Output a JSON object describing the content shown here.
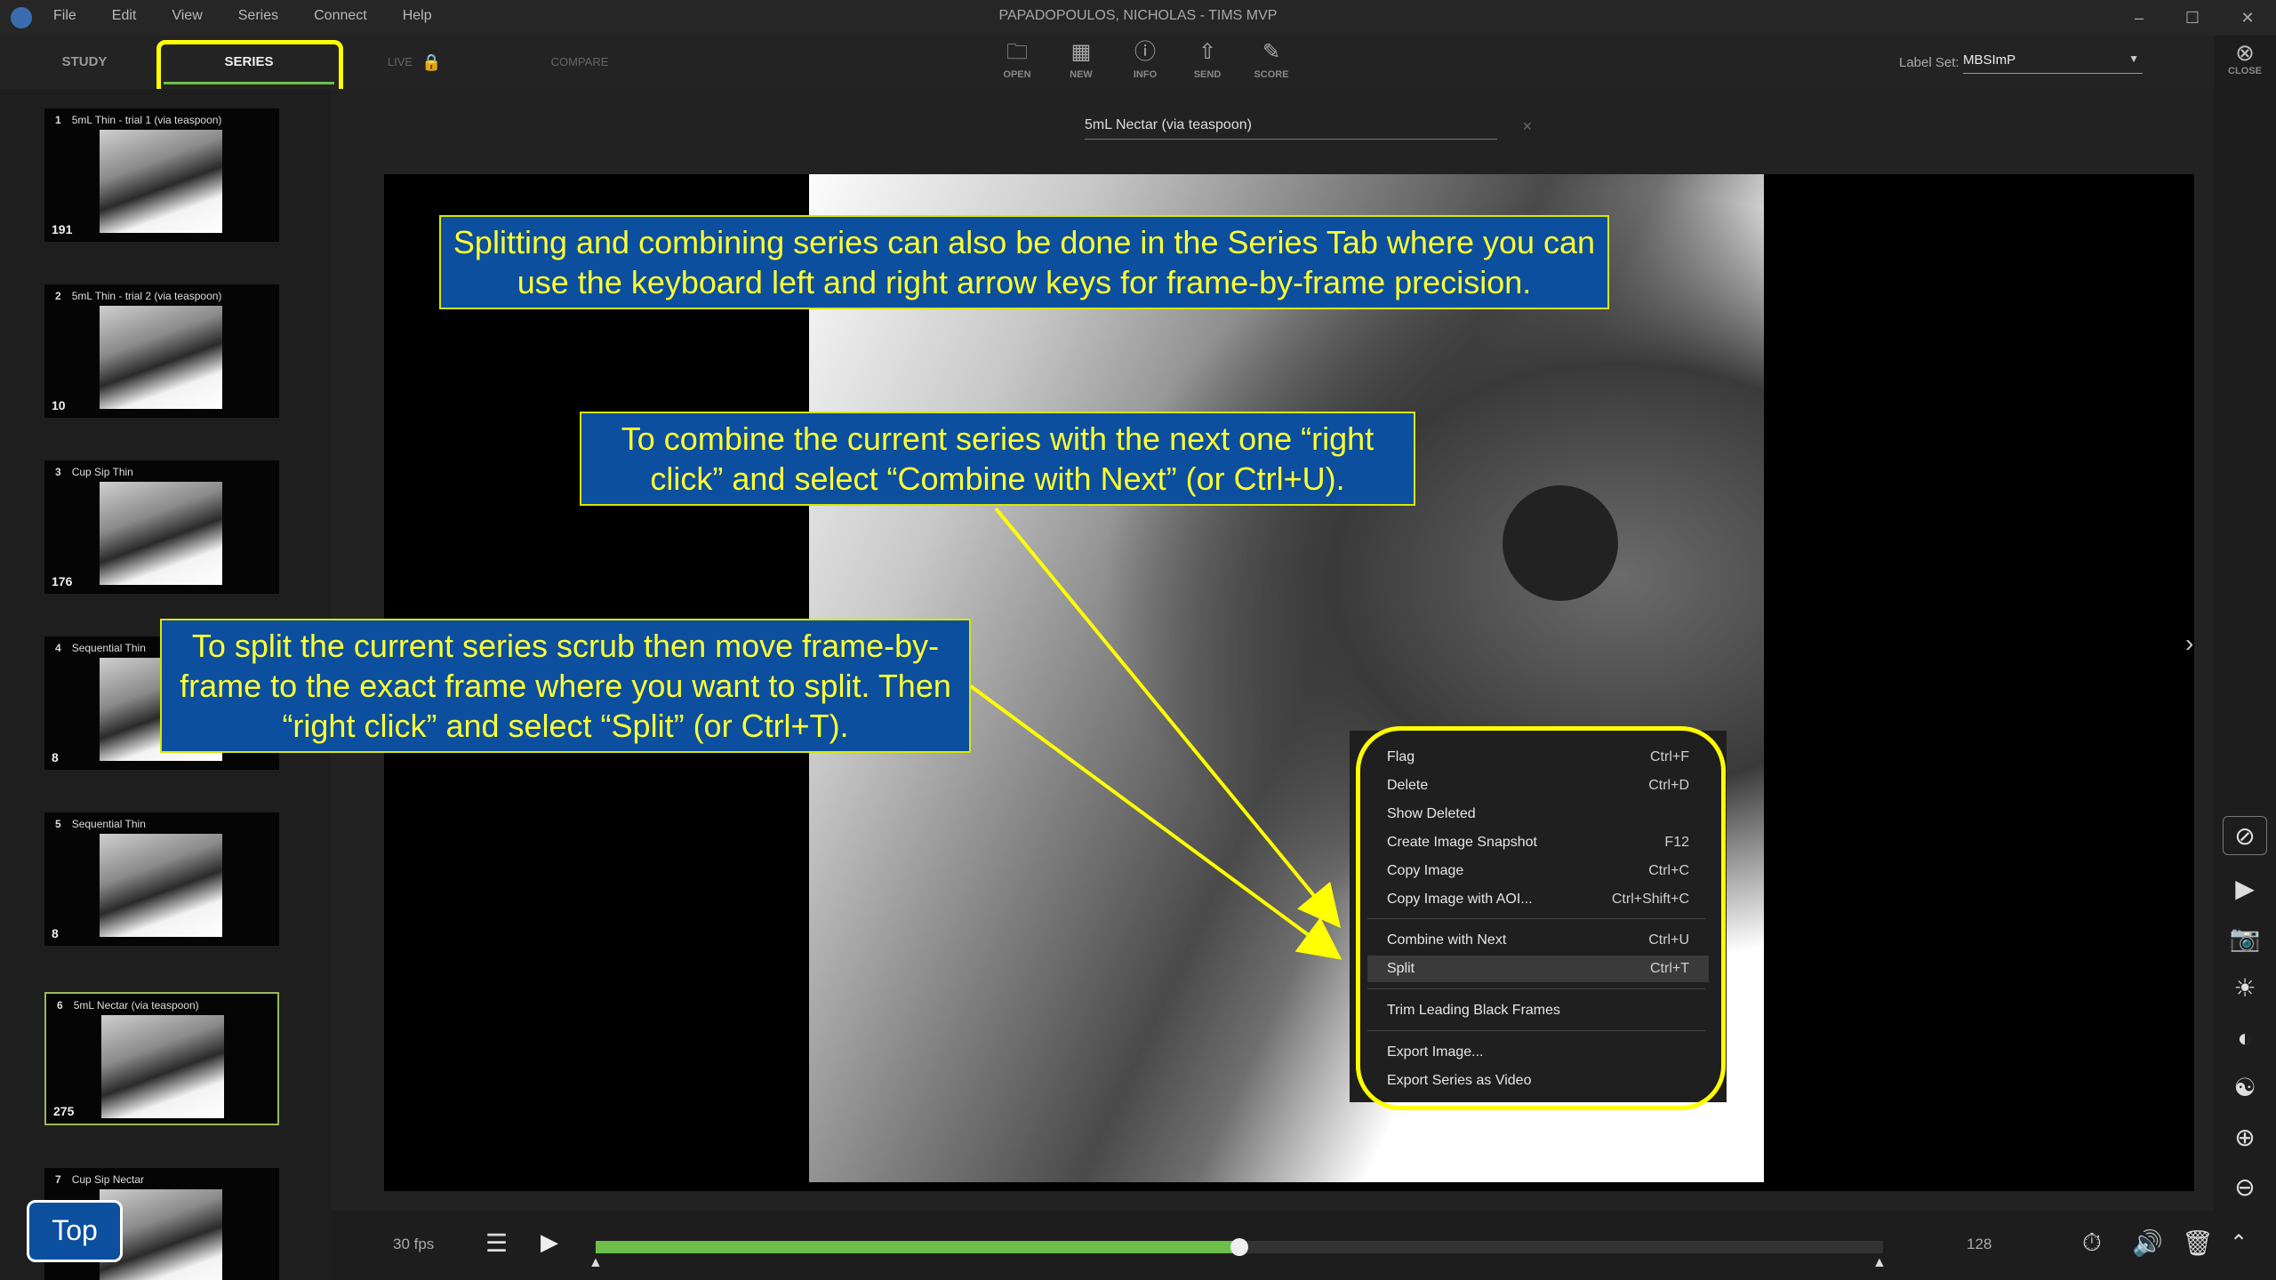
{
  "app": {
    "title": "PAPADOPOULOS, NICHOLAS - TIMS MVP",
    "menu": [
      "File",
      "Edit",
      "View",
      "Series",
      "Connect",
      "Help"
    ]
  },
  "tabs": {
    "study": "STUDY",
    "series": "SERIES",
    "live": "LIVE",
    "compare": "COMPARE"
  },
  "toolbar": [
    {
      "label": "OPEN",
      "icon": "folder-icon"
    },
    {
      "label": "NEW",
      "icon": "new-series-icon"
    },
    {
      "label": "INFO",
      "icon": "info-icon"
    },
    {
      "label": "SEND",
      "icon": "send-icon"
    },
    {
      "label": "SCORE",
      "icon": "score-icon"
    }
  ],
  "label_set": {
    "label": "Label Set:",
    "value": "MBSImP"
  },
  "close": {
    "label": "CLOSE"
  },
  "series": [
    {
      "num": "1",
      "title": "5mL Thin - trial 1 (via teaspoon)",
      "frames": "191"
    },
    {
      "num": "2",
      "title": "5mL Thin - trial 2 (via teaspoon)",
      "frames": "10"
    },
    {
      "num": "3",
      "title": "Cup Sip Thin",
      "frames": "176"
    },
    {
      "num": "4",
      "title": "Sequential Thin",
      "frames": "8"
    },
    {
      "num": "5",
      "title": "Sequential Thin",
      "frames": "8"
    },
    {
      "num": "6",
      "title": "5mL Nectar (via teaspoon)",
      "frames": "275"
    },
    {
      "num": "7",
      "title": "Cup Sip Nectar",
      "frames": ""
    }
  ],
  "viewer": {
    "series_title": "5mL Nectar (via teaspoon)"
  },
  "callouts": {
    "tab": "Splitting and combining series can also be done in the Series Tab where you can use the keyboard left and right arrow keys for frame-by-frame precision.",
    "combine": "To combine the current series with the next one “right click” and select “Combine with Next” (or Ctrl+U).",
    "split": "To split the current series scrub then move frame-by-frame to the exact frame where you want to split. Then “right click” and select “Split” (or Ctrl+T)."
  },
  "context_menu": [
    {
      "label": "Flag",
      "shortcut": "Ctrl+F"
    },
    {
      "label": "Delete",
      "shortcut": "Ctrl+D"
    },
    {
      "label": "Show Deleted",
      "shortcut": ""
    },
    {
      "label": "Create Image Snapshot",
      "shortcut": "F12"
    },
    {
      "label": "Copy Image",
      "shortcut": "Ctrl+C"
    },
    {
      "label": "Copy Image with AOI...",
      "shortcut": "Ctrl+Shift+C"
    },
    {
      "label": "Combine with Next",
      "shortcut": "Ctrl+U"
    },
    {
      "label": "Split",
      "shortcut": "Ctrl+T"
    },
    {
      "label": "Trim Leading Black Frames",
      "shortcut": ""
    },
    {
      "label": "Export Image...",
      "shortcut": ""
    },
    {
      "label": "Export Series as Video",
      "shortcut": ""
    }
  ],
  "playback": {
    "fps": "30 fps",
    "frame": "128",
    "progress": 0.5,
    "accent": "#6cc04a"
  },
  "highlight_color": "#ffff00",
  "callout_color": "#0b4f9e",
  "top_button": "Top"
}
